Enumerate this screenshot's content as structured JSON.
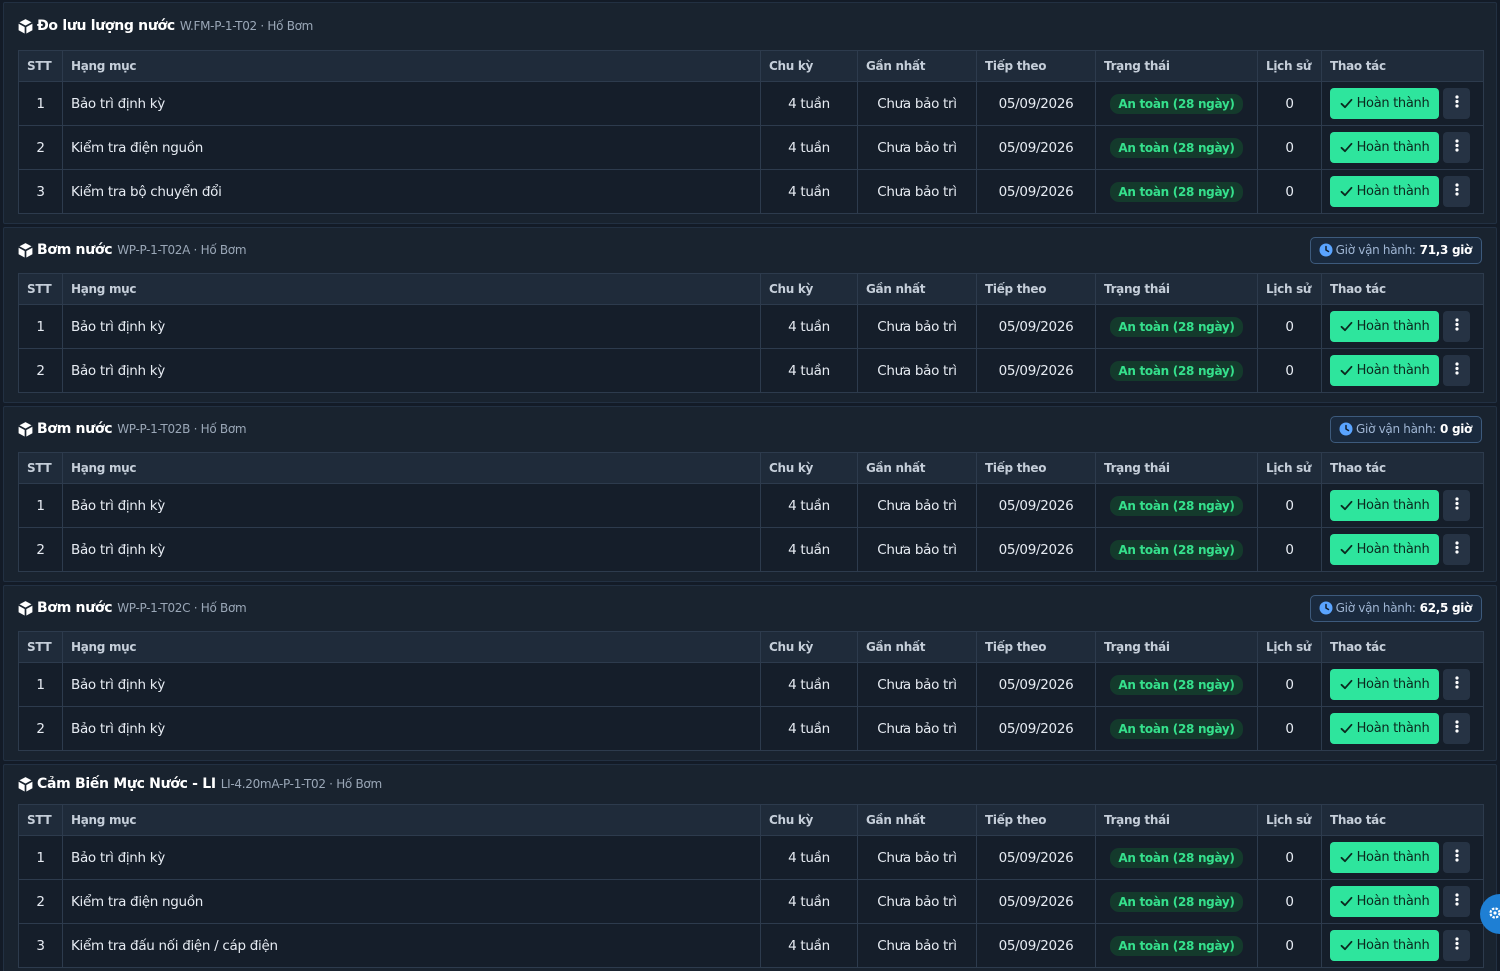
{
  "table_headers": {
    "stt": "STT",
    "item": "Hạng mục",
    "cycle": "Chu kỳ",
    "last": "Gần nhất",
    "next": "Tiếp theo",
    "status": "Trạng thái",
    "history": "Lịch sử",
    "actions": "Thao tác"
  },
  "hours_label": "Giờ vận hành:",
  "colors": {
    "accent_green": "#2ee59d",
    "status_text": "#35e08c",
    "background": "#131b27"
  },
  "sections": [
    {
      "name": "Đo lưu lượng nước",
      "code": "W.FM-P-1-T02 · Hố Bơm",
      "hours": "",
      "rows": [
        {
          "stt": "1",
          "item": "Bảo trì định kỳ",
          "cycle": "4 tuần",
          "last": "Chưa bảo trì",
          "next": "05/09/2026",
          "status": "An toàn (28 ngày)",
          "history": "0",
          "action": "Hoàn thành"
        },
        {
          "stt": "2",
          "item": "Kiểm tra điện nguồn",
          "cycle": "4 tuần",
          "last": "Chưa bảo trì",
          "next": "05/09/2026",
          "status": "An toàn (28 ngày)",
          "history": "0",
          "action": "Hoàn thành"
        },
        {
          "stt": "3",
          "item": "Kiểm tra bộ chuyển đổi",
          "cycle": "4 tuần",
          "last": "Chưa bảo trì",
          "next": "05/09/2026",
          "status": "An toàn (28 ngày)",
          "history": "0",
          "action": "Hoàn thành"
        }
      ]
    },
    {
      "name": "Bơm nước",
      "code": "WP-P-1-T02A · Hố Bơm",
      "hours": "71,3 giờ",
      "rows": [
        {
          "stt": "1",
          "item": "Bảo trì định kỳ",
          "cycle": "4 tuần",
          "last": "Chưa bảo trì",
          "next": "05/09/2026",
          "status": "An toàn (28 ngày)",
          "history": "0",
          "action": "Hoàn thành"
        },
        {
          "stt": "2",
          "item": "Bảo trì định kỳ",
          "cycle": "4 tuần",
          "last": "Chưa bảo trì",
          "next": "05/09/2026",
          "status": "An toàn (28 ngày)",
          "history": "0",
          "action": "Hoàn thành"
        }
      ]
    },
    {
      "name": "Bơm nước",
      "code": "WP-P-1-T02B · Hố Bơm",
      "hours": "0 giờ",
      "rows": [
        {
          "stt": "1",
          "item": "Bảo trì định kỳ",
          "cycle": "4 tuần",
          "last": "Chưa bảo trì",
          "next": "05/09/2026",
          "status": "An toàn (28 ngày)",
          "history": "0",
          "action": "Hoàn thành"
        },
        {
          "stt": "2",
          "item": "Bảo trì định kỳ",
          "cycle": "4 tuần",
          "last": "Chưa bảo trì",
          "next": "05/09/2026",
          "status": "An toàn (28 ngày)",
          "history": "0",
          "action": "Hoàn thành"
        }
      ]
    },
    {
      "name": "Bơm nước",
      "code": "WP-P-1-T02C · Hố Bơm",
      "hours": "62,5 giờ",
      "rows": [
        {
          "stt": "1",
          "item": "Bảo trì định kỳ",
          "cycle": "4 tuần",
          "last": "Chưa bảo trì",
          "next": "05/09/2026",
          "status": "An toàn (28 ngày)",
          "history": "0",
          "action": "Hoàn thành"
        },
        {
          "stt": "2",
          "item": "Bảo trì định kỳ",
          "cycle": "4 tuần",
          "last": "Chưa bảo trì",
          "next": "05/09/2026",
          "status": "An toàn (28 ngày)",
          "history": "0",
          "action": "Hoàn thành"
        }
      ]
    },
    {
      "name": "Cảm Biến Mực Nước - LI",
      "code": "LI-4.20mA-P-1-T02 · Hố Bơm",
      "hours": "",
      "rows": [
        {
          "stt": "1",
          "item": "Bảo trì định kỳ",
          "cycle": "4 tuần",
          "last": "Chưa bảo trì",
          "next": "05/09/2026",
          "status": "An toàn (28 ngày)",
          "history": "0",
          "action": "Hoàn thành"
        },
        {
          "stt": "2",
          "item": "Kiểm tra điện nguồn",
          "cycle": "4 tuần",
          "last": "Chưa bảo trì",
          "next": "05/09/2026",
          "status": "An toàn (28 ngày)",
          "history": "0",
          "action": "Hoàn thành"
        },
        {
          "stt": "3",
          "item": "Kiểm tra đấu nối điện / cáp điện",
          "cycle": "4 tuần",
          "last": "Chưa bảo trì",
          "next": "05/09/2026",
          "status": "An toàn (28 ngày)",
          "history": "0",
          "action": "Hoàn thành"
        }
      ]
    }
  ]
}
